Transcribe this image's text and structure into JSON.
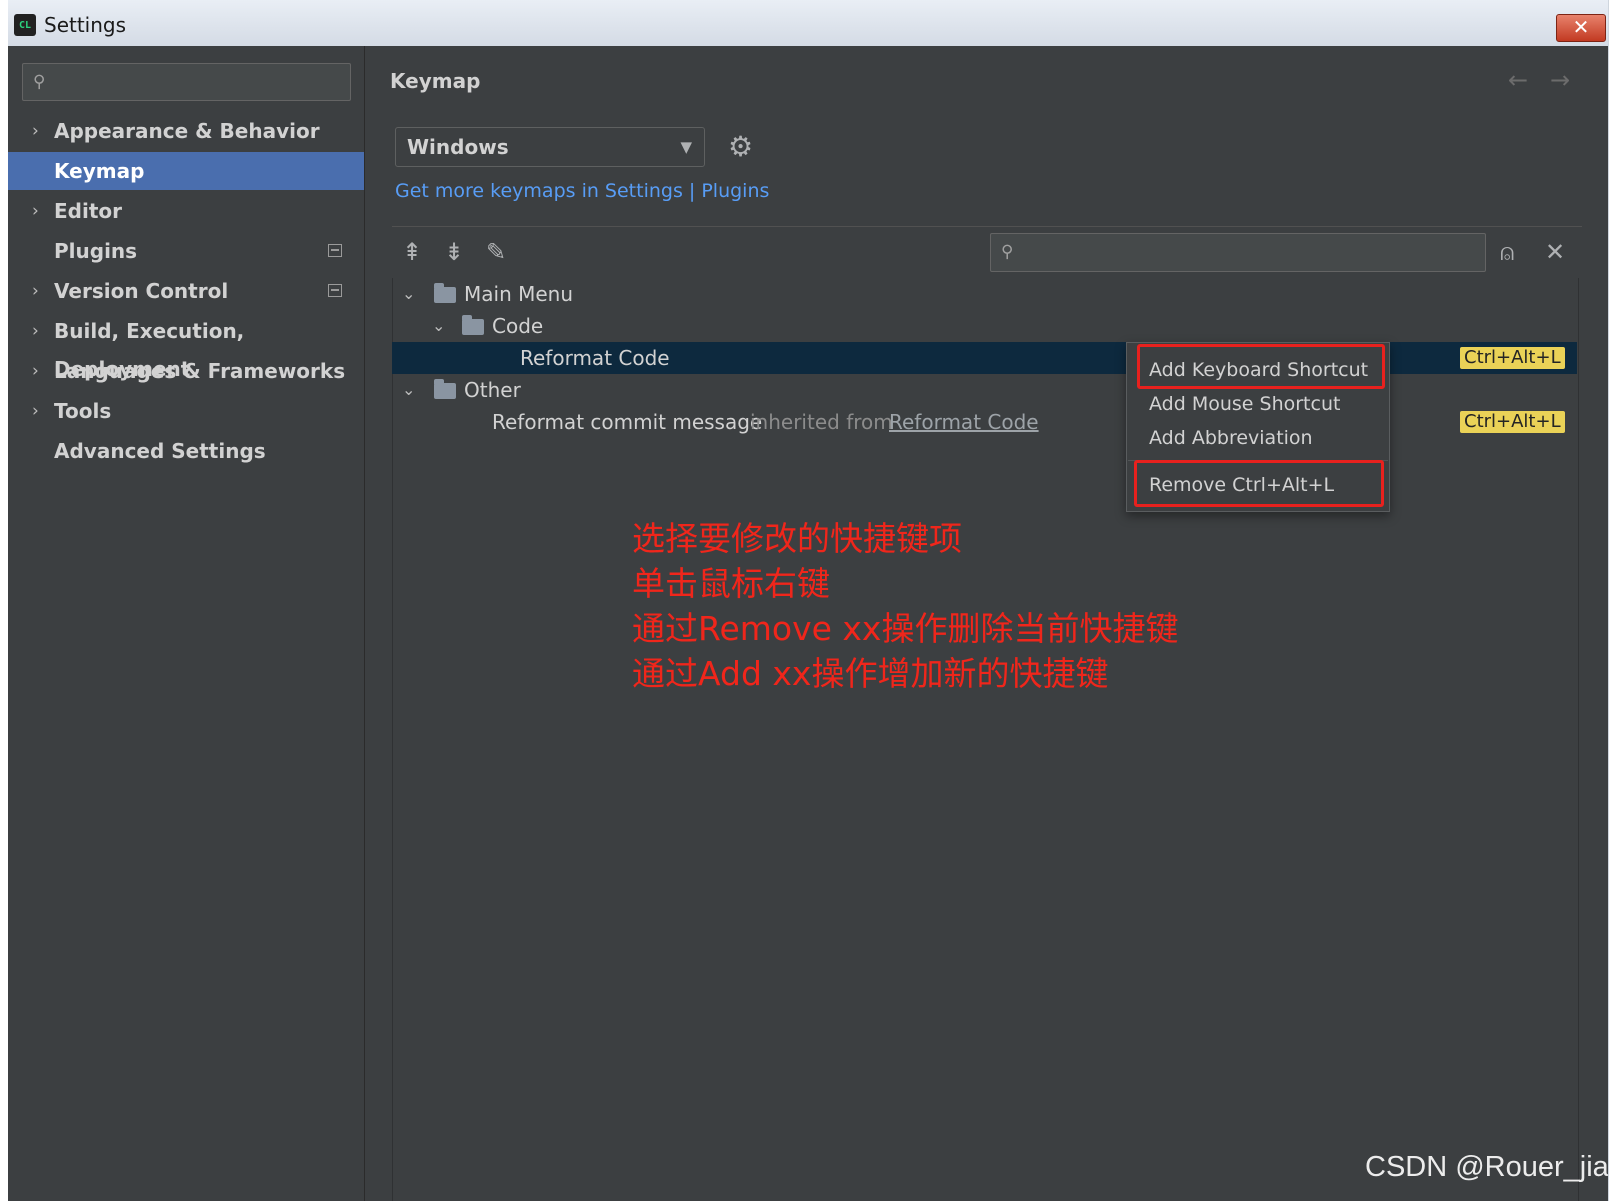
{
  "window": {
    "title": "Settings",
    "app_icon_text": "CL",
    "close_glyph": "✕"
  },
  "sidebar": {
    "search_glyph": "⚲",
    "items": [
      {
        "label": "Appearance & Behavior",
        "chevron": "›"
      },
      {
        "label": "Keymap",
        "selected": true
      },
      {
        "label": "Editor",
        "chevron": "›"
      },
      {
        "label": "Plugins"
      },
      {
        "label": "Version Control",
        "chevron": "›"
      },
      {
        "label": "Build, Execution, Deployment",
        "chevron": "›"
      },
      {
        "label": "Languages & Frameworks",
        "chevron": "›"
      },
      {
        "label": "Tools",
        "chevron": "›"
      },
      {
        "label": "Advanced Settings"
      }
    ]
  },
  "main": {
    "title": "Keymap",
    "back_glyph": "←",
    "forward_glyph": "→",
    "keymap_select": {
      "value": "Windows",
      "caret": "▼"
    },
    "gear_glyph": "⚙",
    "plugins_link": "Get more keymaps in Settings | Plugins",
    "toolbar": {
      "expand_all": "⇞",
      "collapse_all": "⇟",
      "edit": "✎",
      "find_shortcut": "⍝",
      "close": "✕"
    },
    "tree_search_glyph": "⚲",
    "tree": {
      "main_menu": "Main Menu",
      "code": "Code",
      "reformat_code": "Reformat Code",
      "reformat_shortcut": "Ctrl+Alt+L",
      "other": "Other",
      "reformat_commit": "Reformat commit message",
      "inherited_from": "inherited from",
      "inherited_link": "Reformat Code",
      "commit_shortcut": "Ctrl+Alt+L",
      "expand_glyph": "⌄"
    }
  },
  "context_menu": {
    "items": [
      "Add Keyboard Shortcut",
      "Add Mouse Shortcut",
      "Add Abbreviation",
      "Remove Ctrl+Alt+L"
    ]
  },
  "annotation": {
    "lines": [
      "选择要修改的快捷键项",
      "单击鼠标右键",
      "通过Remove xx操作删除当前快捷键",
      "通过Add xx操作增加新的快捷键"
    ]
  },
  "watermark": "CSDN @Rouer_jia",
  "colors": {
    "background": "#3c3f41",
    "selection": "#4a6eae",
    "link": "#589df6",
    "shortcut_badge": "#ead257",
    "highlight_box": "#e8211e",
    "annotation_text": "#f0261b"
  }
}
